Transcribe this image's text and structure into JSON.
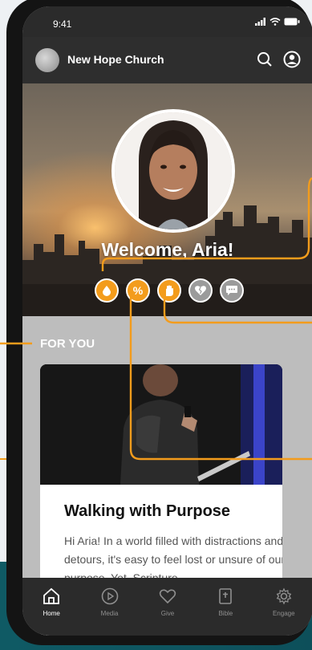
{
  "status": {
    "time": "9:41"
  },
  "header": {
    "church_name": "New Hope Church"
  },
  "hero": {
    "welcome": "Welcome, Aria!"
  },
  "quick_icons": [
    {
      "name": "drop",
      "color": "#f39c1c"
    },
    {
      "name": "percent",
      "label": "%",
      "color": "#f39c1c"
    },
    {
      "name": "hand",
      "color": "#f39c1c"
    },
    {
      "name": "heart",
      "color": "#9b9b9b"
    },
    {
      "name": "chat",
      "color": "#9b9b9b"
    }
  ],
  "section": {
    "for_you": "FOR YOU"
  },
  "card": {
    "title": "Walking with Purpose",
    "body": "Hi Aria! In a world filled with distractions and detours, it's easy to feel lost or unsure of our purpose. Yet, Scripture"
  },
  "tabs": [
    {
      "label": "Home",
      "icon": "home-icon"
    },
    {
      "label": "Media",
      "icon": "play-icon"
    },
    {
      "label": "Give",
      "icon": "heart-icon"
    },
    {
      "label": "Bible",
      "icon": "bible-icon"
    },
    {
      "label": "Engage",
      "icon": "gear-icon"
    }
  ],
  "colors": {
    "accent": "#f39c1c",
    "dark": "#2b2b2b"
  }
}
